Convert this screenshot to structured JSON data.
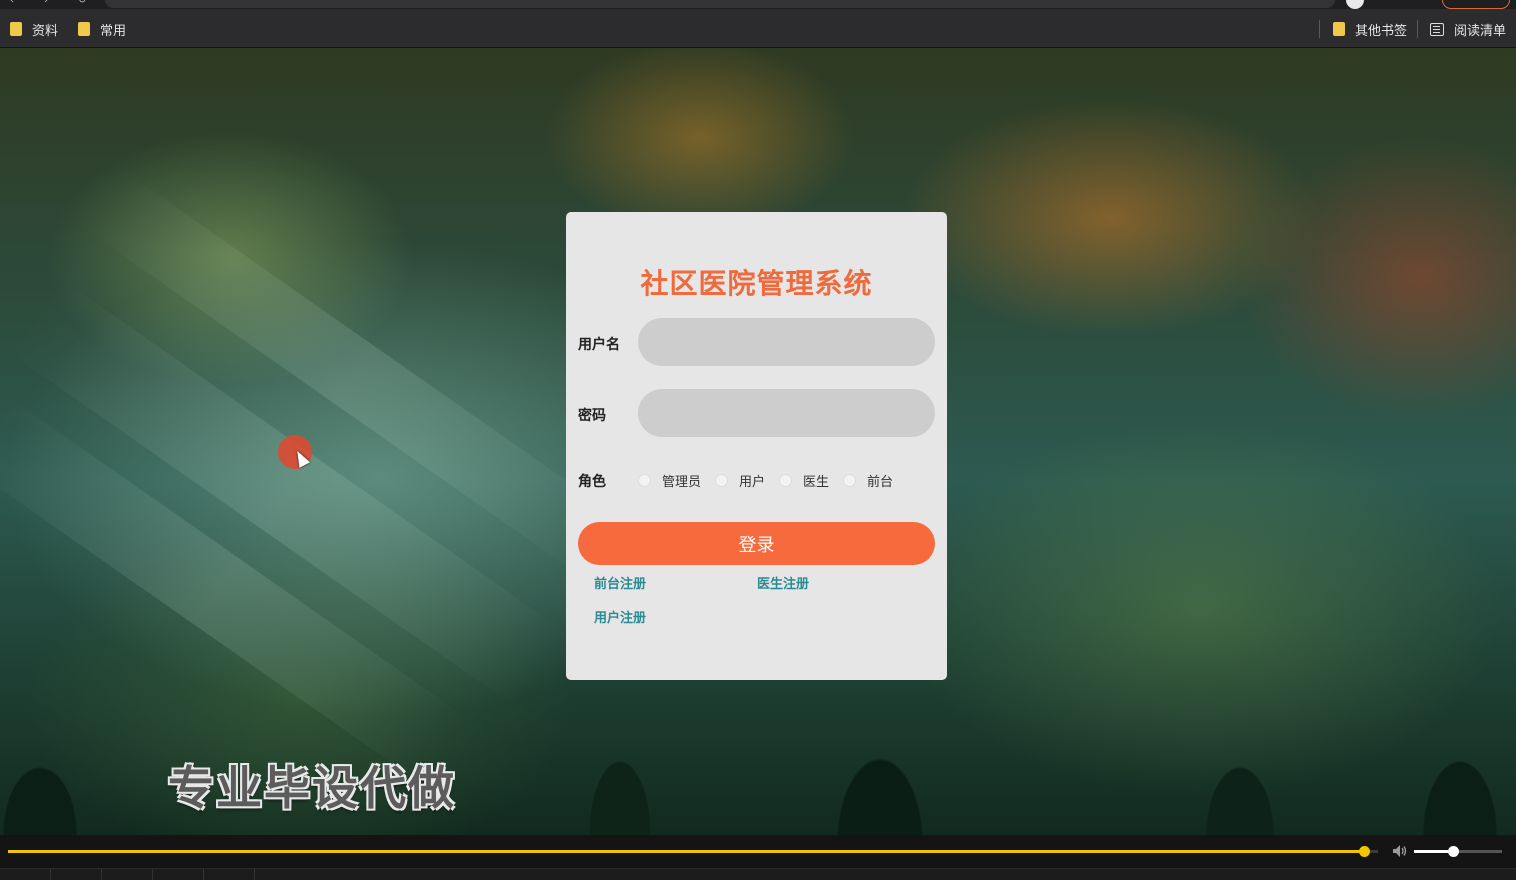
{
  "bookmarks_bar": {
    "left": [
      {
        "label": "资料",
        "icon": "folder-icon"
      },
      {
        "label": "常用",
        "icon": "folder-icon"
      }
    ],
    "right": [
      {
        "label": "其他书签",
        "icon": "folder-icon"
      },
      {
        "label": "阅读清单",
        "icon": "reading-list-icon"
      }
    ]
  },
  "login": {
    "title": "社区医院管理系统",
    "username_label": "用户名",
    "username_value": "",
    "password_label": "密码",
    "password_value": "",
    "role_label": "角色",
    "roles": [
      "管理员",
      "用户",
      "医生",
      "前台"
    ],
    "selected_role": null,
    "submit_label": "登录",
    "links": {
      "front_register": "前台注册",
      "doctor_register": "医生注册",
      "user_register": "用户注册"
    }
  },
  "overlay": {
    "watermark_text": "专业毕设代做"
  },
  "player": {
    "progress_fraction": 0.989,
    "volume_fraction": 0.44
  },
  "colors": {
    "accent": "#f66a3d",
    "title": "#ef6a3d",
    "link": "#2a8b93",
    "card_bg": "#e6e6e6",
    "progress": "#f3c400"
  }
}
